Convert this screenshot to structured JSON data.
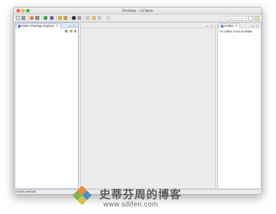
{
  "window": {
    "title": "Desktop - LiClipse"
  },
  "toolbar": {
    "icons": [
      "new-file-icon",
      "save-icon",
      "print-icon",
      "debug-icon",
      "run-icon",
      "external-tools-icon",
      "open-type-icon",
      "search-icon",
      "pydev-icon",
      "next-annotation-icon",
      "prev-annotation-icon",
      "back-icon",
      "forward-icon"
    ],
    "quick_access_placeholder": "Quick Access"
  },
  "pkg_explorer": {
    "tab_label": "PyDev Package Explorer",
    "close_glyph": "✕"
  },
  "outline": {
    "tab_label": "Outline",
    "close_glyph": "✕",
    "message": "An outline is not available."
  },
  "status": {
    "text": "0 items selected"
  },
  "watermark": {
    "cn_text": "史蒂芬周的博客",
    "url": "www.sdifen.com"
  },
  "colors": {
    "accent_blue": "#9fb3d5",
    "close": "#fc605c",
    "minimize": "#fdbc40",
    "maximize": "#34c84a"
  }
}
